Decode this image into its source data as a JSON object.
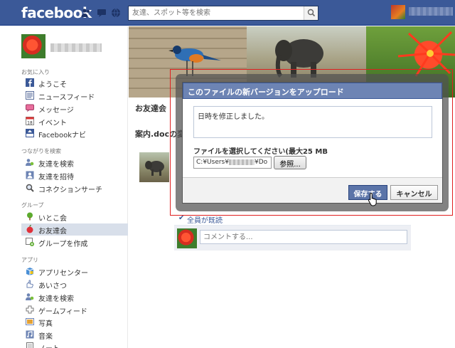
{
  "topbar": {
    "logo": "facebook",
    "search_placeholder": "友達、スポット等を検索",
    "bar_color": "#3b5998"
  },
  "leftnav": {
    "favorites_head": "お気に入り",
    "favorites": [
      {
        "label": "ようこそ",
        "icon": "facebook-f-icon"
      },
      {
        "label": "ニュースフィード",
        "icon": "news-feed-icon"
      },
      {
        "label": "メッセージ",
        "icon": "messages-icon"
      },
      {
        "label": "イベント",
        "icon": "calendar-icon"
      },
      {
        "label": "Facebookナビ",
        "icon": "navi-icon"
      }
    ],
    "connect_head": "つながりを検索",
    "connect": [
      {
        "label": "友達を検索",
        "icon": "find-friends-icon"
      },
      {
        "label": "友達を招待",
        "icon": "invite-icon"
      },
      {
        "label": "コネクションサーチ",
        "icon": "magnifier-icon"
      }
    ],
    "groups_head": "グループ",
    "groups": [
      {
        "label": "いとこ会",
        "icon": "tree-icon",
        "selected": false
      },
      {
        "label": "お友達会",
        "icon": "apple-icon",
        "selected": true
      },
      {
        "label": "グループを作成",
        "icon": "create-group-icon",
        "selected": false
      }
    ],
    "apps_head": "アプリ",
    "apps": [
      {
        "label": "アプリセンター",
        "icon": "app-center-icon"
      },
      {
        "label": "あいさつ",
        "icon": "pokes-icon"
      },
      {
        "label": "友達を検索",
        "icon": "find-friends-icon"
      },
      {
        "label": "ゲームフィード",
        "icon": "game-feed-icon"
      },
      {
        "label": "写真",
        "icon": "photos-icon"
      },
      {
        "label": "音楽",
        "icon": "music-icon"
      },
      {
        "label": "ノート",
        "icon": "notes-icon"
      }
    ]
  },
  "main": {
    "group_title": "お友達会",
    "doc_title": "案内.docの変",
    "seen_label": "全員が既読",
    "comment_placeholder": "コメントする..."
  },
  "dialog": {
    "title": "このファイルの新バージョンをアップロード",
    "description": "日時を修正しました。",
    "file_label": "ファイルを選択してください(最大25 MB",
    "file_path_prefix": "C:¥Users¥",
    "file_path_suffix": "¥Do",
    "browse_label": "参照...",
    "save_label": "保存する",
    "cancel_label": "キャンセル",
    "highlight_color": "#e02020"
  }
}
